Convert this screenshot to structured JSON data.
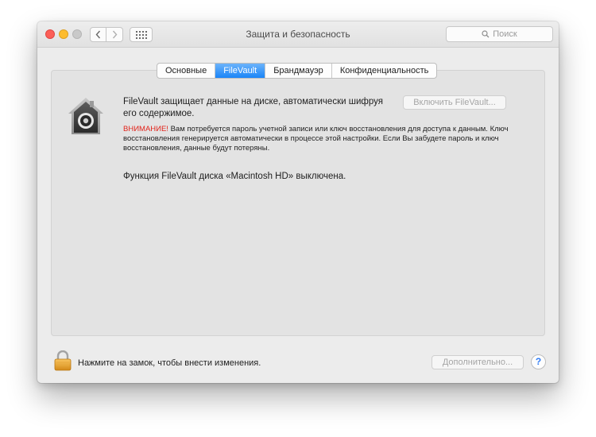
{
  "window": {
    "title": "Защита и безопасность",
    "search_placeholder": "Поиск"
  },
  "tabs": [
    {
      "label": "Основные",
      "active": false
    },
    {
      "label": "FileVault",
      "active": true
    },
    {
      "label": "Брандмауэр",
      "active": false
    },
    {
      "label": "Конфиденциальность",
      "active": false
    }
  ],
  "filevault": {
    "description": "FileVault защищает данные на диске, автоматически шифруя его содержимое.",
    "enable_button": "Включить FileVault...",
    "warning_label": "ВНИМАНИЕ!",
    "warning_text": " Вам потребуется пароль учетной записи или ключ восстановления для доступа к данным. Ключ восстановления генерируется автоматически в процессе этой настройки. Если Вы забудете пароль и ключ восстановления, данные будут потеряны.",
    "status": "Функция FileVault диска «Macintosh HD» выключена."
  },
  "footer": {
    "lock_text": "Нажмите на замок, чтобы внести изменения.",
    "advanced_button": "Дополнительно...",
    "help_label": "?"
  },
  "colors": {
    "active_tab": "#1b85f8",
    "warning": "#e2231a",
    "close": "#fc5f57",
    "minimize": "#fdbc2e"
  },
  "icons": [
    "back-chevron-icon",
    "forward-chevron-icon",
    "grid-icon",
    "search-icon",
    "filevault-house-icon",
    "lock-icon",
    "help-icon"
  ]
}
